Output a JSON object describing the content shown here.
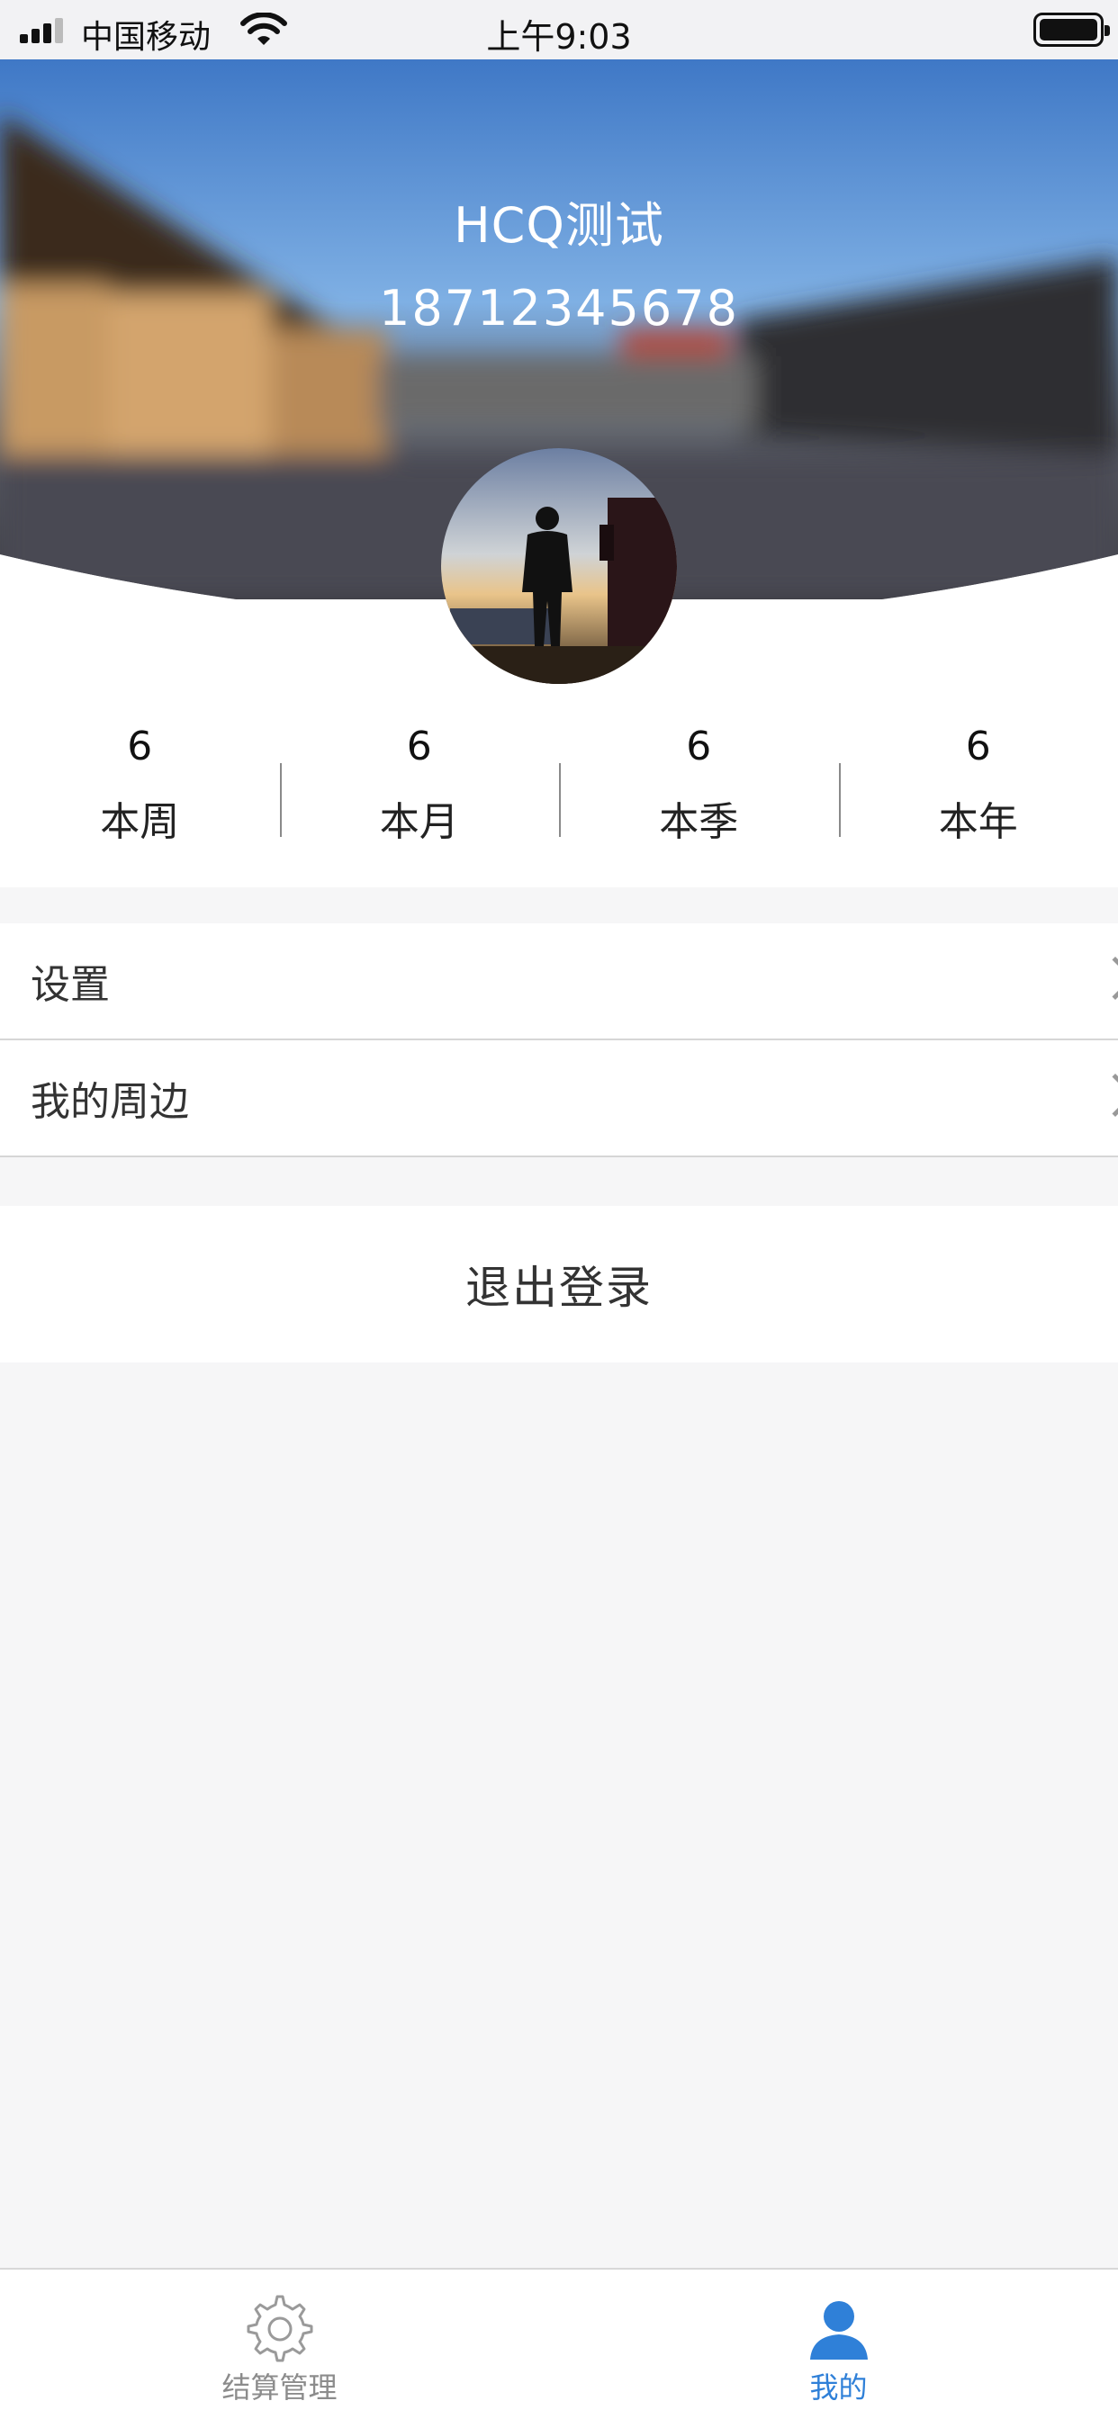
{
  "status_bar": {
    "carrier": "中国移动",
    "time": "上午9:03",
    "signal_icon": "cellular-signal-icon",
    "wifi_icon": "wifi-icon",
    "battery_icon": "battery-icon"
  },
  "profile": {
    "name": "HCQ测试",
    "phone": "18712345678",
    "avatar": "driver-silhouette-avatar"
  },
  "stats": [
    {
      "value": "6",
      "label": "本周"
    },
    {
      "value": "6",
      "label": "本月"
    },
    {
      "value": "6",
      "label": "本季"
    },
    {
      "value": "6",
      "label": "本年"
    }
  ],
  "menu": {
    "items": [
      {
        "label": "设置",
        "icon": "chevron-right-icon"
      },
      {
        "label": "我的周边",
        "icon": "chevron-right-icon"
      }
    ]
  },
  "logout": {
    "label": "退出登录"
  },
  "tabbar": {
    "tabs": [
      {
        "label": "结算管理",
        "icon": "gear-icon",
        "active": false
      },
      {
        "label": "我的",
        "icon": "user-icon",
        "active": true
      }
    ]
  },
  "colors": {
    "accent": "#2f80d8",
    "page_background": "#f6f6f7",
    "inactive_tab": "#8c8c8c"
  }
}
